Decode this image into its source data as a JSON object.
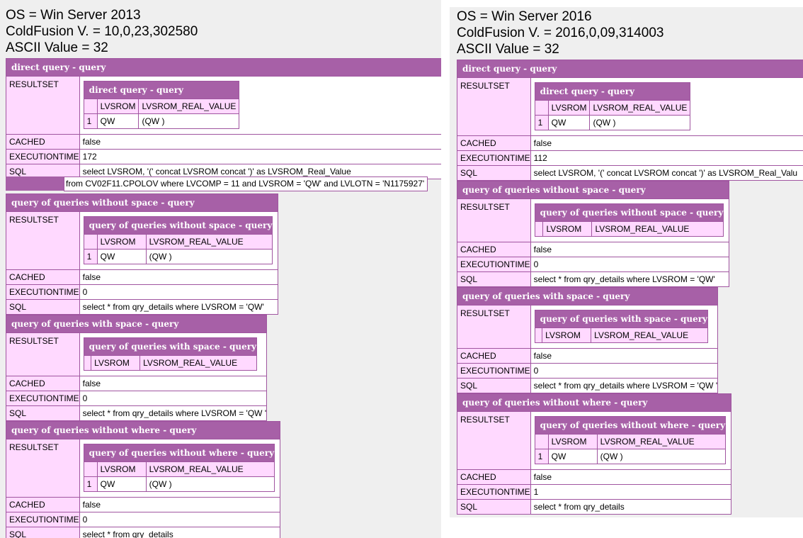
{
  "left": {
    "env": {
      "os": "OS = Win Server 2013",
      "cf": "ColdFusion V. = 10,0,23,302580",
      "ascii": "ASCII Value = 32"
    },
    "direct": {
      "title": "direct query - query",
      "inner_title": "direct query - query",
      "col1": "LVSROM",
      "col2": "LVSROM_REAL_VALUE",
      "row_num": "1",
      "row_c1": "QW",
      "row_c2": "(QW )",
      "cached": "false",
      "exectime": "172",
      "sql": "select LVSROM, '(' concat LVSROM concat ')' as LVSROM_Real_Value",
      "sql2": "from CV02F11.CPOLOV where LVCOMP = 11 and LVSROM = 'QW' and LVLOTN = 'N1175927'"
    },
    "q1": {
      "title": "query of queries without space - query",
      "inner_title": "query of queries without space - query",
      "col1": "LVSROM",
      "col2": "LVSROM_REAL_VALUE",
      "row_num": "1",
      "row_c1": "QW",
      "row_c2": "(QW )",
      "cached": "false",
      "exectime": "0",
      "sql": "select * from qry_details where LVSROM = 'QW'"
    },
    "q2": {
      "title": "query of queries with space - query",
      "inner_title": "query of queries with space - query",
      "col1": "LVSROM",
      "col2": "LVSROM_REAL_VALUE",
      "cached": "false",
      "exectime": "0",
      "sql": "select * from qry_details where LVSROM = 'QW '"
    },
    "q3": {
      "title": "query of queries without where - query",
      "inner_title": "query of queries without where - query",
      "col1": "LVSROM",
      "col2": "LVSROM_REAL_VALUE",
      "row_num": "1",
      "row_c1": "QW",
      "row_c2": "(QW )",
      "cached": "false",
      "exectime": "0",
      "sql": "select * from qry_details"
    }
  },
  "right": {
    "env": {
      "os": "OS = Win Server 2016",
      "cf": "ColdFusion V. = 2016,0,09,314003",
      "ascii": "ASCII Value = 32"
    },
    "direct": {
      "title": "direct query - query",
      "inner_title": "direct query - query",
      "col1": "LVSROM",
      "col2": "LVSROM_REAL_VALUE",
      "row_num": "1",
      "row_c1": "QW",
      "row_c2": "(QW )",
      "cached": "false",
      "exectime": "112",
      "sql": "select LVSROM, '(' concat LVSROM concat ')' as LVSROM_Real_Valu"
    },
    "q1": {
      "title": "query of queries without space - query",
      "inner_title": "query of queries without space - query",
      "col1": "LVSROM",
      "col2": "LVSROM_REAL_VALUE",
      "cached": "false",
      "exectime": "0",
      "sql": "select * from qry_details where LVSROM = 'QW'"
    },
    "q2": {
      "title": "query of queries with space - query",
      "inner_title": "query of queries with space - query",
      "col1": "LVSROM",
      "col2": "LVSROM_REAL_VALUE",
      "cached": "false",
      "exectime": "0",
      "sql": "select * from qry_details where LVSROM = 'QW '"
    },
    "q3": {
      "title": "query of queries without where - query",
      "inner_title": "query of queries without where - query",
      "col1": "LVSROM",
      "col2": "LVSROM_REAL_VALUE",
      "row_num": "1",
      "row_c1": "QW",
      "row_c2": "(QW )",
      "cached": "false",
      "exectime": "1",
      "sql": "select * from qry_details"
    }
  },
  "labels": {
    "resultset": "RESULTSET",
    "cached": "CACHED",
    "exectime": "EXECUTIONTIME",
    "sql": "SQL"
  },
  "colors": {
    "title_bg": "#a760a7",
    "label_bg": "#ffd9ff",
    "border": "#a055a0",
    "page_bg": "#efefef"
  }
}
